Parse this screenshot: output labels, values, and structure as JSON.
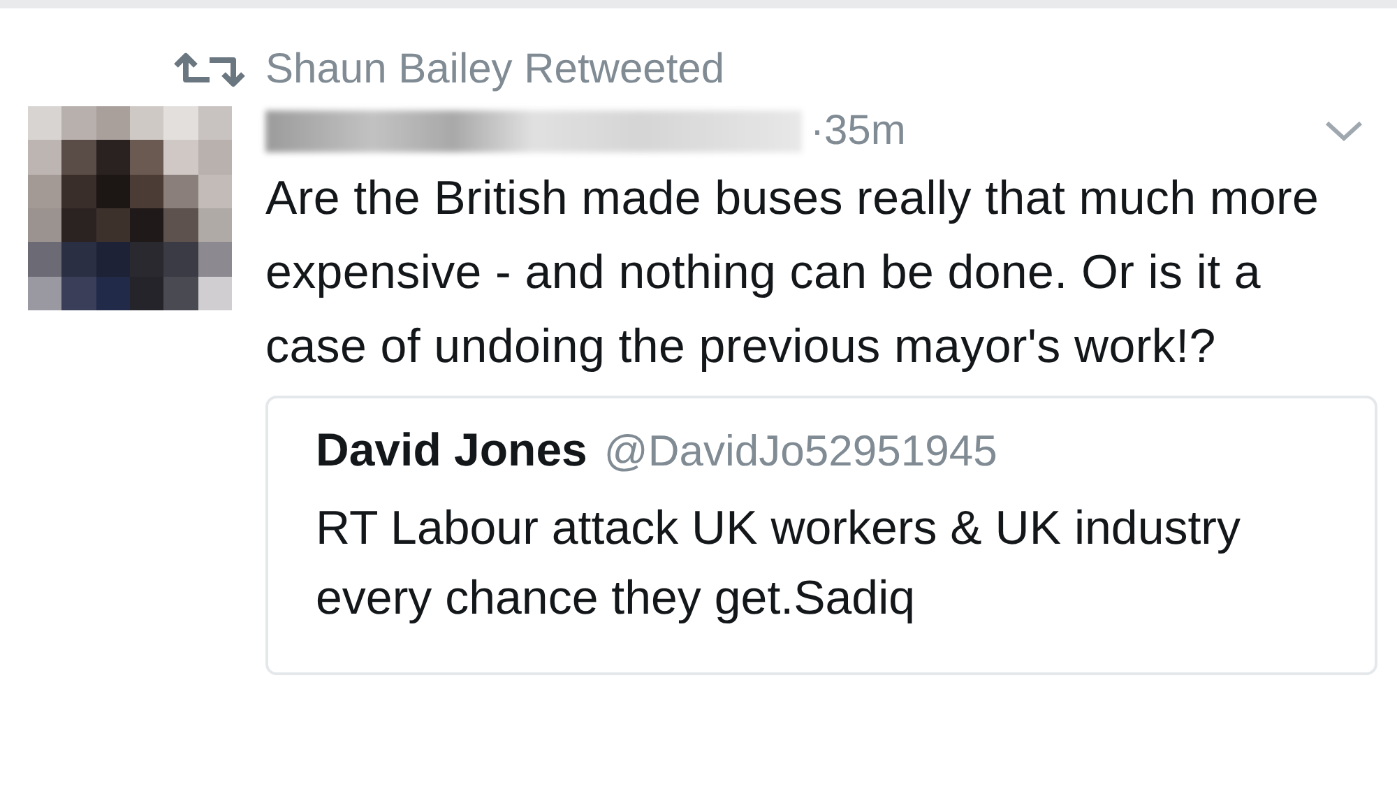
{
  "retweet_banner": {
    "text": "Shaun Bailey Retweeted"
  },
  "tweet": {
    "time": "·35m",
    "text": "Are the British made buses really that much more expensive - and nothing can be done. Or is it a case of undoing the previous mayor's work!?",
    "quoted_tweet": {
      "name": "David Jones",
      "handle": "@DavidJo52951945",
      "text": "RT Labour attack UK workers & UK industry every chance they get.Sadiq"
    }
  }
}
